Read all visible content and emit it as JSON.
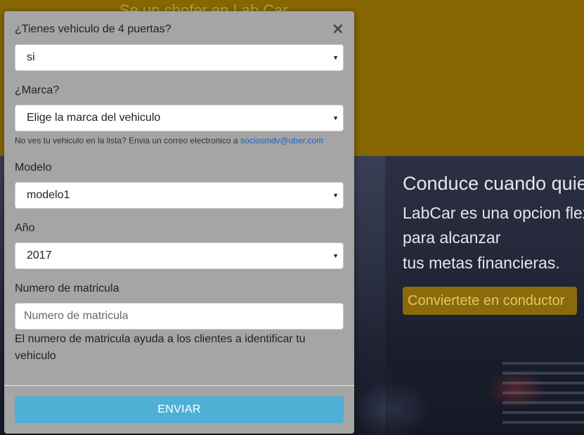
{
  "background": {
    "top_banner_text": "Se un chofer en Lab Car",
    "hero": {
      "title": "Conduce cuando quieras",
      "lines": [
        "LabCar es una opcion flexible",
        "para alcanzar",
        "tus metas financieras."
      ],
      "cta_label": "Conviertete en conductor"
    },
    "colors": {
      "banner": "#866600",
      "cta_bg": "#8a6a0a",
      "cta_text": "#e0c75a"
    }
  },
  "modal": {
    "close_symbol": "×",
    "fields": {
      "doors": {
        "label": "¿Tienes vehiculo de 4 puertas?",
        "selected": "si"
      },
      "brand": {
        "label": "¿Marca?",
        "selected": "Elige la marca del vehiculo",
        "help_prefix": "No ves tu vehiculo en la lista? Envia un correo electronico a ",
        "help_email": "sociosmdv@uber.com"
      },
      "model": {
        "label": "Modelo",
        "selected": "modelo1"
      },
      "year": {
        "label": "Año",
        "selected": "2017"
      },
      "plate": {
        "label": "Numero de matricula",
        "value": "",
        "placeholder": "Numero de matricula",
        "help": "El numero de matricula ayuda a los clientes a identificar tu vehiculo"
      }
    },
    "submit_label": "ENVIAR",
    "colors": {
      "background": "#a5a5a5",
      "submit": "#4fb0d6",
      "link": "#1f5fc4"
    }
  }
}
